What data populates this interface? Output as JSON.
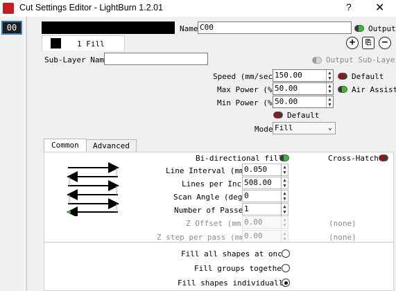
{
  "window": {
    "title": "Cut Settings Editor - LightBurn 1.2.01",
    "help": "?",
    "close": "✕"
  },
  "layer": {
    "index": "00",
    "color": "#000000"
  },
  "name": {
    "label": "Name",
    "value": "C00"
  },
  "output": {
    "label": "Output",
    "on": true
  },
  "sublayer_tab": {
    "label": "1 Fill"
  },
  "sublayer_name": {
    "label": "Sub-Layer Name",
    "value": ""
  },
  "output_sublayer": {
    "label": "Output Sub-Layer"
  },
  "speed": {
    "label": "Speed (mm/sec)",
    "value": "150.00",
    "default_label": "Default"
  },
  "max_power": {
    "label": "Max Power (%)",
    "value": "50.00"
  },
  "air_assist": {
    "label": "Air Assist"
  },
  "min_power": {
    "label": "Min Power (%)",
    "value": "50.00"
  },
  "power_default": {
    "label": "Default"
  },
  "mode": {
    "label": "Mode",
    "value": "Fill"
  },
  "tabs": [
    {
      "label": "Common"
    },
    {
      "label": "Advanced"
    }
  ],
  "bidirectional": {
    "label": "Bi-directional fill"
  },
  "crosshatch": {
    "label": "Cross-Hatch"
  },
  "line_interval": {
    "label": "Line Interval (mm)",
    "value": "0.050"
  },
  "lines_per_inch": {
    "label": "Lines per Inch",
    "value": "508.00"
  },
  "scan_angle": {
    "label": "Scan Angle (deg)",
    "value": "0"
  },
  "num_passes": {
    "label": "Number of Passes",
    "value": "1"
  },
  "z_offset": {
    "label": "Z Offset (mm)",
    "value": "0.00",
    "note": "(none)"
  },
  "z_step": {
    "label": "Z step per pass (mm)",
    "value": "0.00",
    "note": "(none)"
  },
  "fill_options": [
    {
      "label": "Fill all shapes at once",
      "selected": false
    },
    {
      "label": "Fill groups together",
      "selected": false
    },
    {
      "label": "Fill shapes individually",
      "selected": true
    }
  ]
}
